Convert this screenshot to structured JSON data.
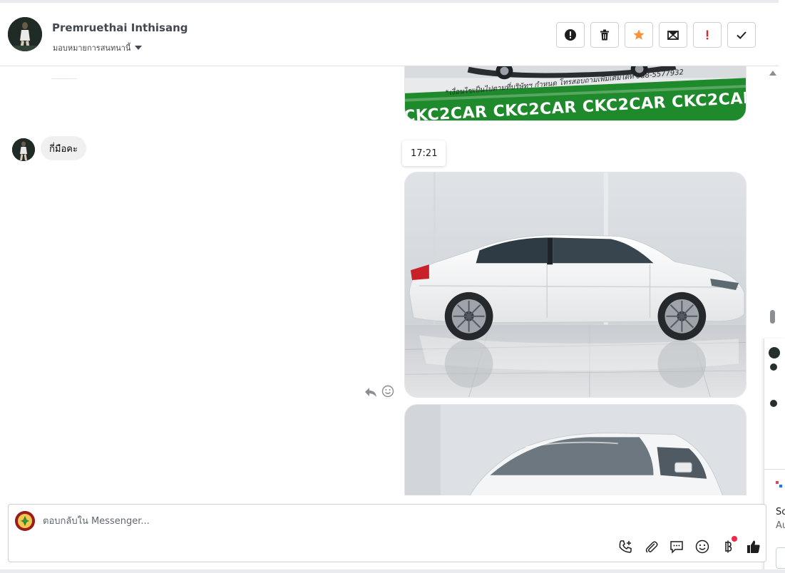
{
  "header": {
    "contact_name": "Premruethai Inthisang",
    "assign_label": "มอบหมายการสนทนานี้"
  },
  "toolbar": {
    "buttons": [
      {
        "name": "report-spam",
        "icon": "alert-circle-icon"
      },
      {
        "name": "delete",
        "icon": "trash-icon"
      },
      {
        "name": "star",
        "icon": "star-icon",
        "color": "#f7923b"
      },
      {
        "name": "mark-unread",
        "icon": "envelope-icon"
      },
      {
        "name": "flag-important",
        "icon": "exclamation-icon",
        "color": "#e02424"
      },
      {
        "name": "mark-done",
        "icon": "check-icon"
      }
    ]
  },
  "thread": {
    "top_image": {
      "banner_note": "*เงื่อนไขเป็นไปตามที่บริษัทฯ กำหนด โทรสอบถามเพิ่มเติมได้ที่ 088-5577932",
      "banner_text": "CKC2CAR CKC2CAR CKC2CAR CKC2CAR CKC2"
    },
    "incoming_message": "กี่มือคะ",
    "timestamp": "17:21"
  },
  "side_panel": {
    "text_line_1": "Sc",
    "text_line_2": "Au"
  },
  "composer": {
    "placeholder": "ตอบกลับใน Messenger..."
  },
  "colors": {
    "banner_green": "#1f8a2c",
    "star": "#f7923b",
    "flag": "#e02424",
    "notification_dot": "#f02849"
  }
}
